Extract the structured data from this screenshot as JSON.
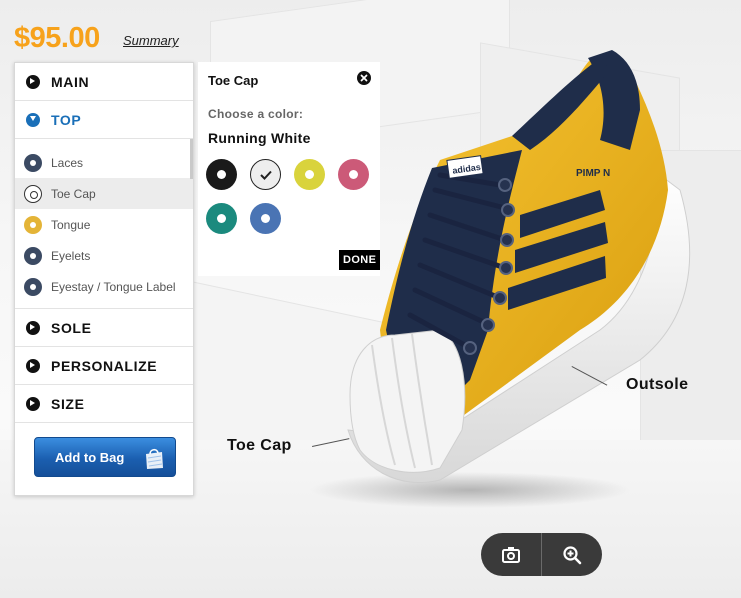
{
  "price": "$95.00",
  "summary_link": "Summary",
  "nav": {
    "main": "MAIN",
    "top": "TOP",
    "top_parts": [
      {
        "label": "Laces",
        "color": "#3b4a63"
      },
      {
        "label": "Toe Cap",
        "color": "#ffffff"
      },
      {
        "label": "Tongue",
        "color": "#e4b437"
      },
      {
        "label": "Eyelets",
        "color": "#3b4a63"
      },
      {
        "label": "Eyestay / Tongue Label",
        "color": "#3b4a63"
      }
    ],
    "sole": "SOLE",
    "personalize": "PERSONALIZE",
    "size": "SIZE"
  },
  "add_to_bag": "Add to Bag",
  "color_panel": {
    "title": "Toe Cap",
    "prompt": "Choose a color:",
    "selected_name": "Running White",
    "swatches": [
      "#1a1a1a",
      "#eeeeee",
      "#d9d33c",
      "#cc5a78",
      "#1b8a7e",
      "#4a74b4"
    ],
    "selected_index": 1,
    "done": "DONE"
  },
  "shoe": {
    "custom_text": "PIMP N",
    "brand_text": "adidas",
    "colors": {
      "body": "#f0b81a",
      "stripes": "#1f2d4a",
      "toe": "#f4f4f4",
      "sole": "#ffffff"
    }
  },
  "callouts": {
    "outsole": "Outsole",
    "toe_cap": "Toe Cap"
  }
}
